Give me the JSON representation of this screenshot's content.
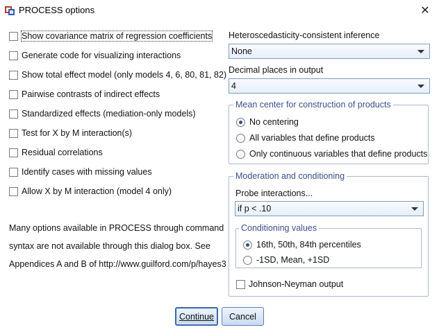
{
  "window": {
    "title": "PROCESS options",
    "close_glyph": "✕"
  },
  "left_options": [
    {
      "label": "Show covariance matrix of regression coefficients",
      "checked": false,
      "focused": true
    },
    {
      "label": "Generate code for visualizing interactions",
      "checked": false
    },
    {
      "label": "Show total effect model (only models 4, 6, 80, 81, 82)",
      "checked": false
    },
    {
      "label": "Pairwise contrasts of indirect effects",
      "checked": false
    },
    {
      "label": "Standardized effects (mediation-only models)",
      "checked": false
    },
    {
      "label": "Test for X by M interaction(s)",
      "checked": false
    },
    {
      "label": "Residual correlations",
      "checked": false
    },
    {
      "label": "Identify cases with missing values",
      "checked": false
    },
    {
      "label": "Allow X by M interaction (model 4 only)",
      "checked": false
    }
  ],
  "info": {
    "line1": "Many options available in PROCESS through command",
    "line2": "syntax are not available through this dialog box.  See",
    "line3": "Appendices A and B of http://www.guilford.com/p/hayes3"
  },
  "hc_inference": {
    "label": "Heteroscedasticity-consistent inference",
    "value": "None"
  },
  "decimal_places": {
    "label": "Decimal places in output",
    "value": "4"
  },
  "mean_center": {
    "title": "Mean center for construction of products",
    "options": [
      {
        "label": "No centering",
        "selected": true
      },
      {
        "label": "All variables that define products",
        "selected": false
      },
      {
        "label": "Only continuous variables that define products",
        "selected": false
      }
    ]
  },
  "moderation": {
    "title": "Moderation and conditioning",
    "probe_label": "Probe interactions...",
    "probe_value": "if p < .10",
    "conditioning": {
      "title": "Conditioning values",
      "options": [
        {
          "label": "16th, 50th, 84th percentiles",
          "selected": true
        },
        {
          "label": "-1SD, Mean, +1SD",
          "selected": false
        }
      ]
    },
    "johnson_neyman": {
      "label": "Johnson-Neyman output",
      "checked": false
    }
  },
  "buttons": {
    "continue_label": "Continue",
    "cancel_label": "Cancel"
  }
}
